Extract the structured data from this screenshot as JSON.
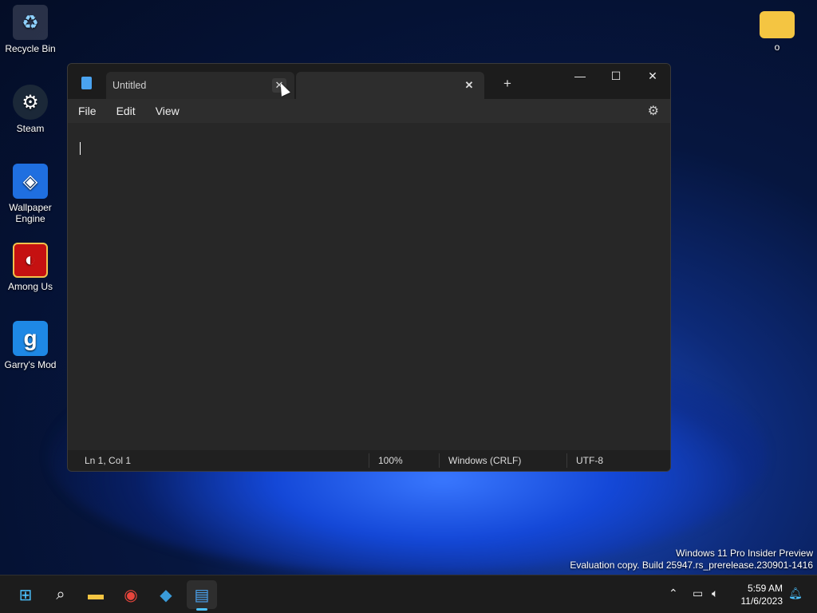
{
  "desktop": {
    "icons": [
      {
        "label": "Recycle Bin",
        "icon": "recycle-bin-icon"
      },
      {
        "label": "Steam",
        "icon": "steam-icon"
      },
      {
        "label": "Wallpaper Engine",
        "icon": "wallpaper-engine-icon"
      },
      {
        "label": "Among Us",
        "icon": "among-us-icon"
      },
      {
        "label": "Garry's Mod",
        "icon": "garrys-mod-icon"
      },
      {
        "label": "o",
        "icon": "folder-icon"
      }
    ],
    "watermark": {
      "line1": "Windows 11 Pro Insider Preview",
      "line2": "Evaluation copy. Build 25947.rs_prerelease.230901-1416"
    }
  },
  "notepad": {
    "tabs": [
      {
        "label": "Untitled",
        "close": "✕"
      },
      {
        "label": "",
        "close": "✕"
      }
    ],
    "new_tab": "+",
    "caption": {
      "minimize": "—",
      "maximize": "☐",
      "close": "✕"
    },
    "menu": {
      "file": "File",
      "edit": "Edit",
      "view": "View"
    },
    "editor_text": "",
    "status": {
      "position": "Ln 1, Col 1",
      "zoom": "100%",
      "line_ending": "Windows (CRLF)",
      "encoding": "UTF-8"
    }
  },
  "taskbar": {
    "apps": [
      "start-icon",
      "search-icon",
      "file-explorer-icon",
      "chrome-icon",
      "app-icon",
      "notepad-icon"
    ],
    "clock": {
      "time": "5:59 AM",
      "date": "11/6/2023"
    }
  }
}
